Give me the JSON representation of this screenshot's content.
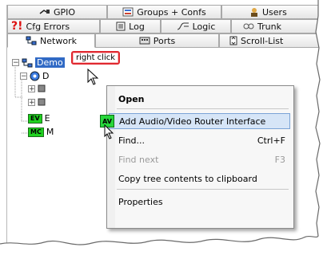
{
  "tabs_row1": [
    {
      "label": "GPIO",
      "icon": "plug-icon"
    },
    {
      "label": "Groups + Confs",
      "icon": "groups-icon"
    },
    {
      "label": "Users",
      "icon": "users-icon"
    }
  ],
  "tabs_row2": [
    {
      "label": "Cfg Errors",
      "icon": "error-icon"
    },
    {
      "label": "Log",
      "icon": "log-icon"
    },
    {
      "label": "Logic",
      "icon": "logic-icon"
    },
    {
      "label": "Trunk",
      "icon": "trunk-icon"
    }
  ],
  "tabs_row3": [
    {
      "label": "Network",
      "icon": "network-icon",
      "active": true
    },
    {
      "label": "Ports",
      "icon": "ports-icon"
    },
    {
      "label": "Scroll-List",
      "icon": "scroll-list-icon"
    }
  ],
  "callout": {
    "text": "right click"
  },
  "tree": {
    "root_label": "Demo",
    "child_d": "D",
    "leaf_e_tag": "EV",
    "leaf_e_text": "E",
    "leaf_m_tag": "MC",
    "leaf_m_text": "M"
  },
  "context_menu": {
    "items": [
      {
        "label": "Open",
        "bold": true
      },
      {
        "label": "Add Audio/Video Router Interface",
        "icon_text": "AV",
        "highlighted": true
      },
      {
        "label": "Find...",
        "shortcut": "Ctrl+F"
      },
      {
        "label": "Find next",
        "shortcut": "F3",
        "disabled": true
      },
      {
        "label": "Copy tree contents to clipboard"
      },
      {
        "label": "Properties"
      }
    ]
  },
  "colors": {
    "selection": "#316ac5",
    "callout_border": "#e0282f",
    "menu_highlight": "#d6e5f7",
    "av_icon": "#27d63b"
  }
}
